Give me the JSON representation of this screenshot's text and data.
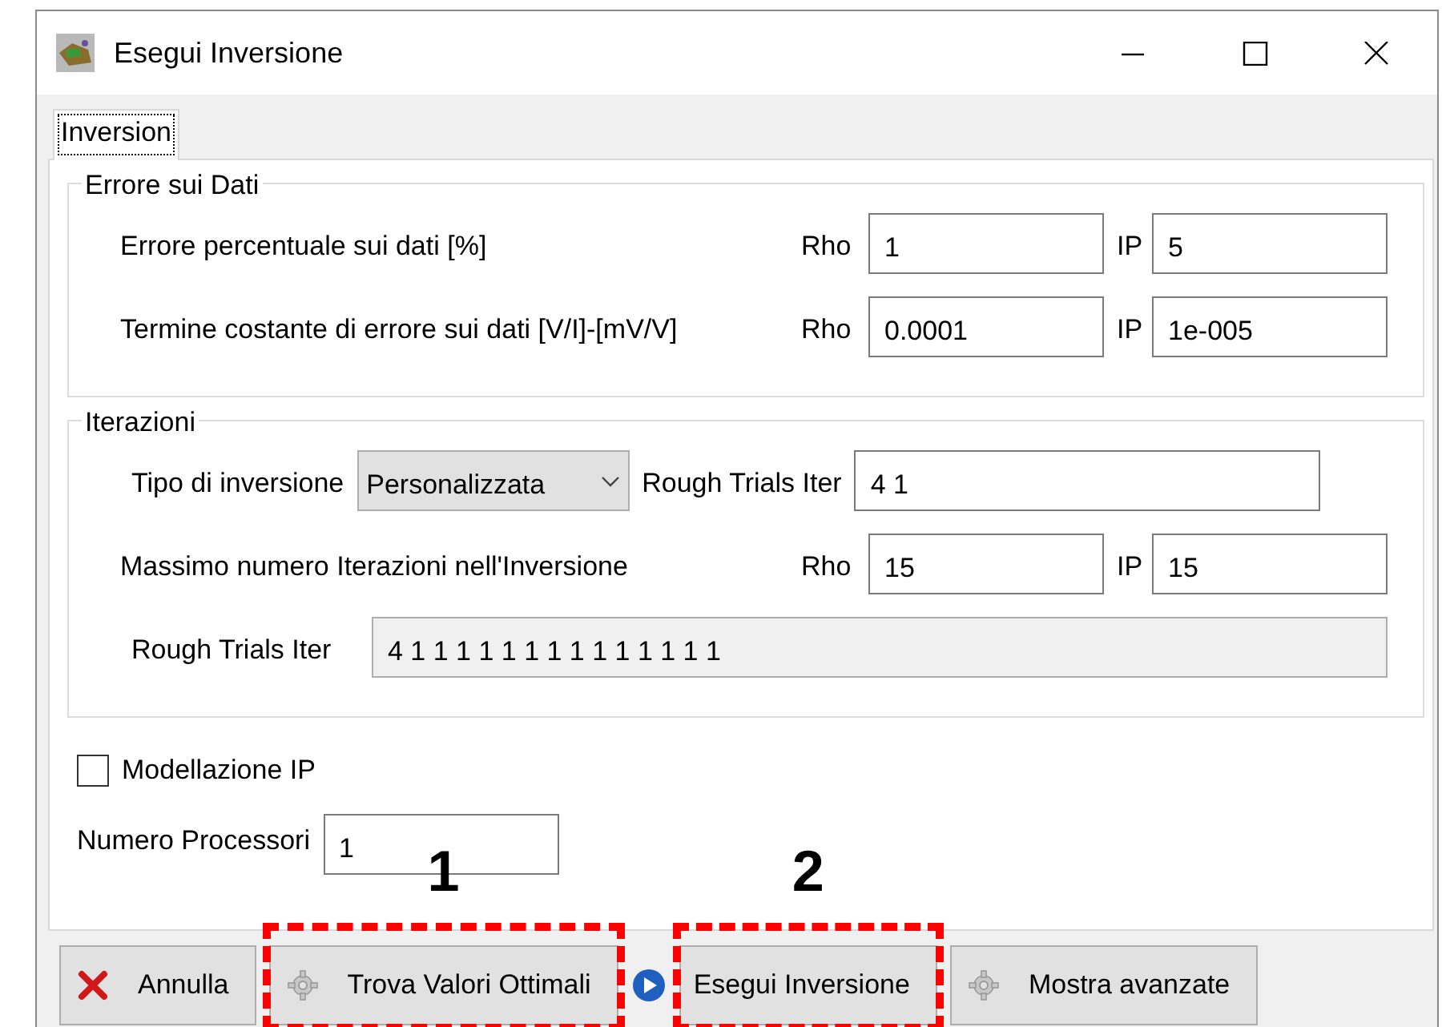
{
  "window": {
    "title": "Esegui Inversione"
  },
  "tabs": [
    {
      "label": "Inversion",
      "selected": true
    }
  ],
  "groups": [
    {
      "title": "Errore sui Dati",
      "rows": [
        {
          "kind": "pair",
          "label": "Errore percentuale sui dati [%]",
          "rho_label": "Rho",
          "rho": "1",
          "ip_label": "IP",
          "ip": "5"
        },
        {
          "kind": "pair",
          "label": "Termine costante di errore sui dati [V/I]-[mV/V]",
          "rho_label": "Rho",
          "rho": "0.0001",
          "ip_label": "IP",
          "ip": "1e-005"
        }
      ]
    },
    {
      "title": "Iterazioni",
      "rows": [
        {
          "kind": "select",
          "label": "Tipo di inversione",
          "value": "Personalizzata",
          "extra_label": "Rough Trials Iter",
          "extra_value": "4 1"
        },
        {
          "kind": "pair",
          "label": "Massimo numero Iterazioni nell'Inversione",
          "rho_label": "Rho",
          "rho": "15",
          "ip_label": "IP",
          "ip": "15"
        },
        {
          "kind": "readonly",
          "label": "Rough Trials Iter",
          "value": "4 1 1 1 1 1 1 1 1 1 1 1 1 1 1"
        }
      ]
    }
  ],
  "options": [
    {
      "label": "Modellazione IP",
      "checked": false
    }
  ],
  "processors": {
    "label": "Numero Processori",
    "value": "1"
  },
  "buttons": [
    {
      "label": "Annulla",
      "kind": "cancel"
    },
    {
      "label": "Trova Valori Ottimali",
      "kind": "tool",
      "annotation": "1"
    },
    {
      "label": "Esegui Inversione",
      "kind": "run",
      "annotation": "2"
    },
    {
      "label": "Mostra avanzate",
      "kind": "tool"
    }
  ]
}
